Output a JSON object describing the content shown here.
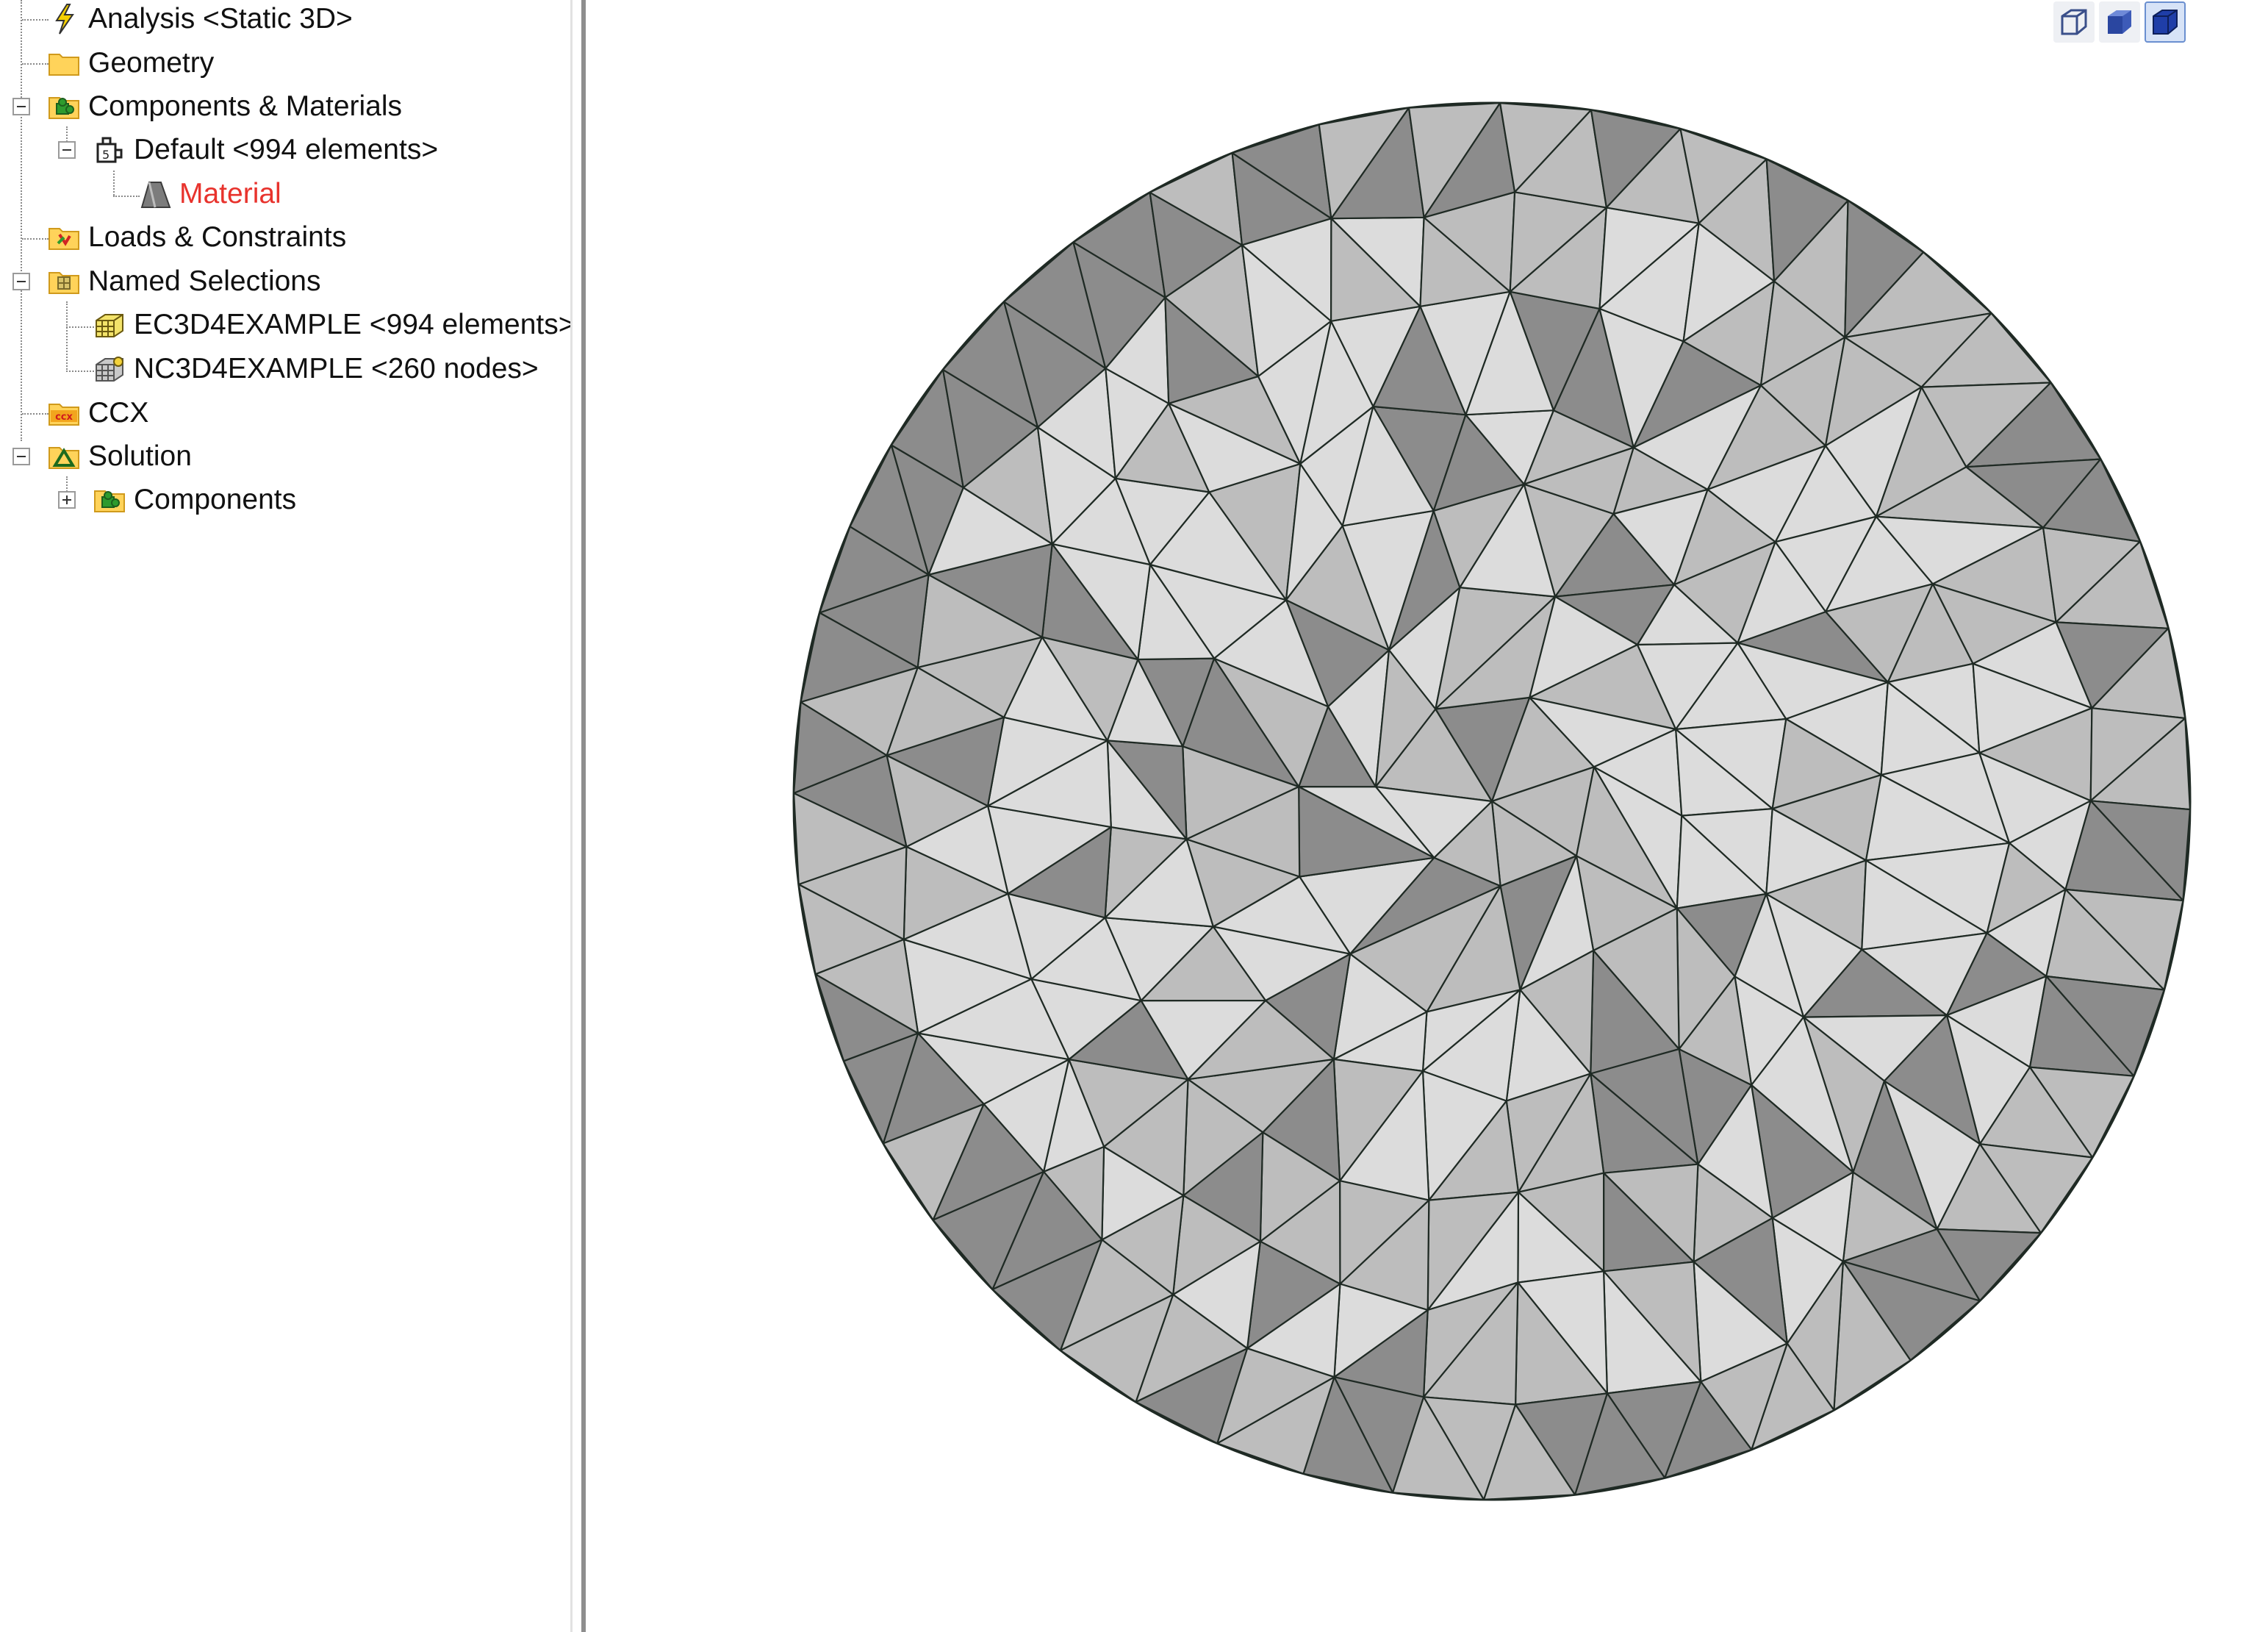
{
  "tree": {
    "items": [
      {
        "label": "Analysis <Static 3D>",
        "icon": "lightning-icon",
        "color": "#111111"
      },
      {
        "label": "Geometry",
        "icon": "folder-icon",
        "color": "#111111"
      },
      {
        "label": "Components & Materials",
        "icon": "components-icon",
        "color": "#111111",
        "expanded": true
      },
      {
        "label": "Default <994 elements>",
        "icon": "part-icon",
        "color": "#111111",
        "expanded": true
      },
      {
        "label": "Material",
        "icon": "material-icon",
        "color": "#e8332d"
      },
      {
        "label": "Loads & Constraints",
        "icon": "loads-icon",
        "color": "#111111"
      },
      {
        "label": "Named Selections",
        "icon": "named-selections-icon",
        "color": "#111111",
        "expanded": true
      },
      {
        "label": "EC3D4EXAMPLE <994 elements>",
        "icon": "element-set-icon",
        "color": "#111111"
      },
      {
        "label": "NC3D4EXAMPLE <260 nodes>",
        "icon": "node-set-icon",
        "color": "#111111"
      },
      {
        "label": "CCX",
        "icon": "ccx-icon",
        "color": "#111111",
        "badge": "ccx"
      },
      {
        "label": "Solution",
        "icon": "solution-icon",
        "color": "#111111",
        "expanded": true
      },
      {
        "label": "Components",
        "icon": "components-icon",
        "color": "#111111",
        "expanded": false
      }
    ]
  },
  "viewport": {
    "toolbar": [
      {
        "name": "wireframe-view-button",
        "icon": "wireframe-cube-icon",
        "active": false
      },
      {
        "name": "shaded-view-button",
        "icon": "shaded-cube-icon",
        "active": false
      },
      {
        "name": "shaded-edges-view-button",
        "icon": "shaded-edges-cube-icon",
        "active": true
      }
    ],
    "mesh_colors": {
      "light": "#dcdcdc",
      "mid": "#bdbdbd",
      "dark": "#8c8c8c",
      "edge": "#1f2a24"
    }
  }
}
